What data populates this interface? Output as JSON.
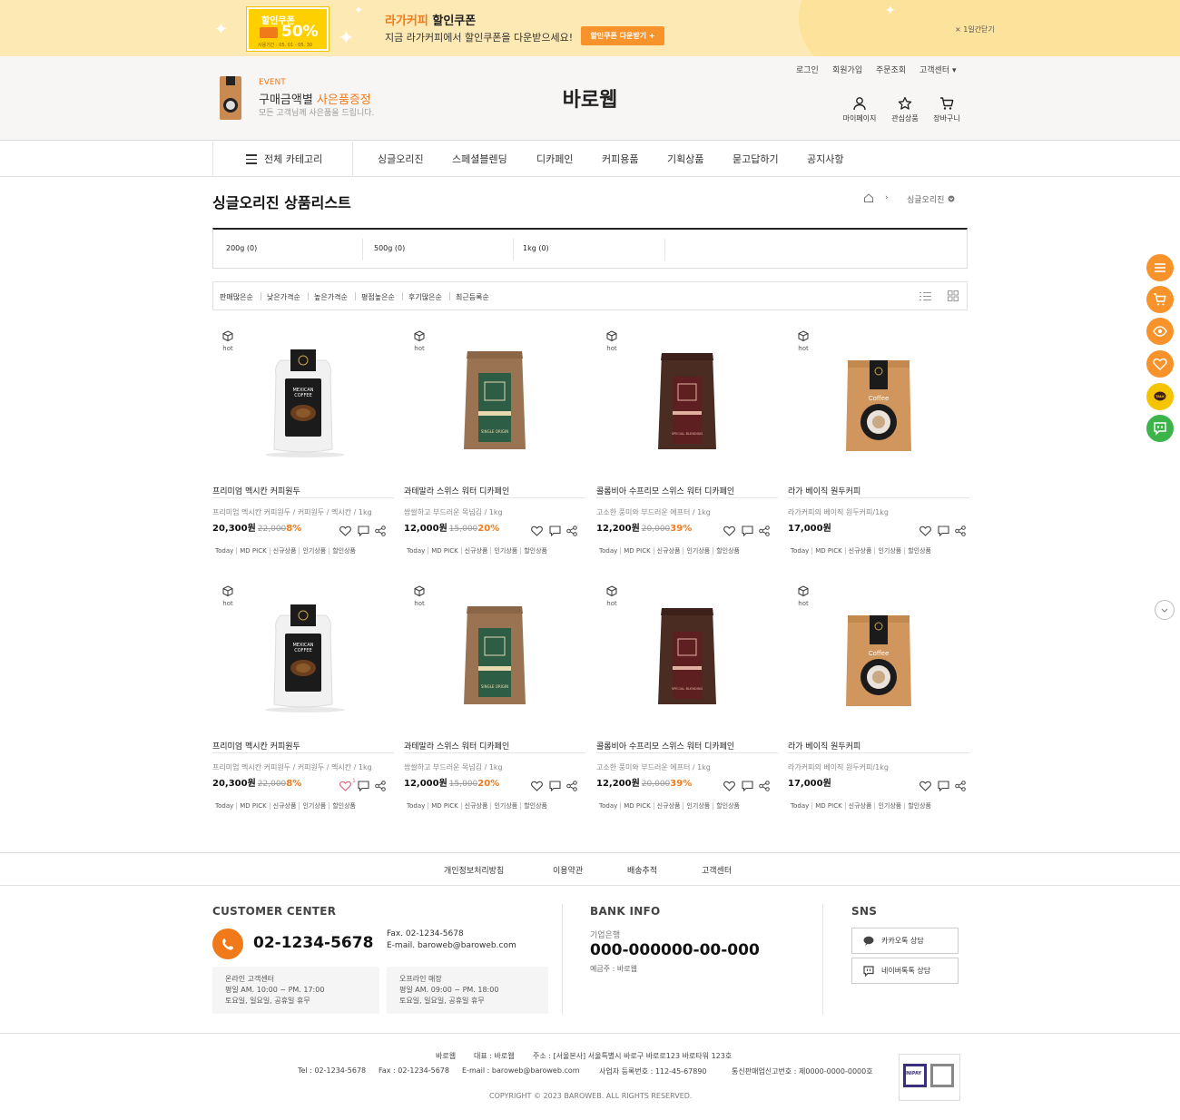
{
  "banner": {
    "coupon_line1": "할인쿠폰",
    "coupon_percent": "50%",
    "coupon_period": "사용기간 : 05. 01 - 05. 30",
    "title_brand": "라가커피",
    "title_rest": " 할인쿠폰",
    "subtitle": "지금 라가커피에서 할인쿠폰을 다운받으세요!",
    "download_button": "할인쿠폰 다운받기 +",
    "close_label": "× 1일간닫기"
  },
  "header": {
    "top_menu": [
      "로그인",
      "회원가입",
      "주문조회",
      "고객센터 ▾"
    ],
    "event_label": "EVENT",
    "event_title_a": "구매금액별 ",
    "event_title_b": "사은품증정",
    "event_subtitle": "모든 고객님께 사은품을 드립니다.",
    "logo": "바로웹",
    "icons": [
      {
        "icon": "person-icon",
        "label": "마이페이지"
      },
      {
        "icon": "star-icon",
        "label": "관심상품"
      },
      {
        "icon": "cart-icon",
        "label": "장바구니"
      }
    ]
  },
  "nav": {
    "all_category": "전체 카테고리",
    "items": [
      "싱글오리진",
      "스페셜블렌딩",
      "디카페인",
      "커피용품",
      "기획상품",
      "묻고답하기",
      "공지사항"
    ]
  },
  "page": {
    "title": "싱글오리진 상품리스트",
    "breadcrumb_current": "싱글오리진"
  },
  "weight_tabs": [
    "200g (0)",
    "500g (0)",
    "1kg (0)"
  ],
  "sort_options": [
    "판매많은순",
    "낮은가격순",
    "높은가격순",
    "평점높은순",
    "후기많은순",
    "최근등록순"
  ],
  "hot_label": "hot",
  "tags": [
    "Today",
    "MD PICK",
    "신규상품",
    "인기상품",
    "할인상품"
  ],
  "products": [
    {
      "name": "프리미엄 멕시칸 커피원두",
      "desc": "프리미엄 멕시칸 커피원두 / 커피원두 / 멕시칸 / 1kg",
      "price": "20,300원",
      "old_price": "22,000",
      "discount": "8%",
      "pack": "white",
      "pack_text": "MEXICAN COFFEE",
      "like_count": ""
    },
    {
      "name": "과테말라 스위스 워터 디카페인",
      "desc": "쌉쌀하고 부드러운 목넘김 / 1kg",
      "price": "12,000원",
      "old_price": "15,000",
      "discount": "20%",
      "pack": "kraft-green",
      "pack_text": "SINGLE ORIGIN",
      "like_count": ""
    },
    {
      "name": "콜롬비아 수프리모 스위스 워터 디카페인",
      "desc": "고소한 풍미와 부드러운 에프터 / 1kg",
      "price": "12,200원",
      "old_price": "20,000",
      "discount": "39%",
      "pack": "dark-red",
      "pack_text": "SPECIAL BLENDING",
      "like_count": ""
    },
    {
      "name": "라가 베이직 원두커피",
      "desc": "라가커피의 베이직 원두커피/1kg",
      "price": "17,000원",
      "old_price": "",
      "discount": "",
      "pack": "orange",
      "pack_text": "Coffee",
      "like_count": ""
    },
    {
      "name": "프리미엄 멕시칸 커피원두",
      "desc": "프리미엄 멕시칸 커피원두 / 커피원두 / 멕시칸 / 1kg",
      "price": "20,300원",
      "old_price": "22,000",
      "discount": "8%",
      "pack": "white",
      "pack_text": "MEXICAN COFFEE",
      "like_count": "1"
    },
    {
      "name": "과테말라 스위스 워터 디카페인",
      "desc": "쌉쌀하고 부드러운 목넘김 / 1kg",
      "price": "12,000원",
      "old_price": "15,000",
      "discount": "20%",
      "pack": "kraft-green",
      "pack_text": "SINGLE ORIGIN",
      "like_count": ""
    },
    {
      "name": "콜롬비아 수프리모 스위스 워터 디카페인",
      "desc": "고소한 풍미와 부드러운 에프터 / 1kg",
      "price": "12,200원",
      "old_price": "20,000",
      "discount": "39%",
      "pack": "dark-red",
      "pack_text": "SPECIAL BLENDING",
      "like_count": ""
    },
    {
      "name": "라가 베이직 원두커피",
      "desc": "라가커피의 베이직 원두커피/1kg",
      "price": "17,000원",
      "old_price": "",
      "discount": "",
      "pack": "orange",
      "pack_text": "Coffee",
      "like_count": ""
    }
  ],
  "floating": [
    {
      "icon": "menu-icon",
      "color": "#f7932a"
    },
    {
      "icon": "cart-icon",
      "color": "#f7932a"
    },
    {
      "icon": "eye-icon",
      "color": "#f7932a"
    },
    {
      "icon": "heart-icon",
      "color": "#f7932a"
    },
    {
      "icon": "kakao-talk-icon",
      "color": "#f5c400"
    },
    {
      "icon": "chat-icon",
      "color": "#3cb44b"
    }
  ],
  "footer": {
    "links": [
      "개인정보처리방침",
      "이용약관",
      "배송추적",
      "고객센터"
    ],
    "cs_title": "CUSTOMER CENTER",
    "cs_phone": "02-1234-5678",
    "cs_fax": "Fax. 02-1234-5678",
    "cs_email": "E-mail. baroweb@baroweb.com",
    "online_hours": [
      "온라인 고객센터",
      "평일 AM. 10:00 ~ PM. 17:00",
      "토요일, 일요일, 공휴일 휴무"
    ],
    "offline_hours": [
      "오프라인 매장",
      "평일 AM. 09:00 ~ PM. 18:00",
      "토요일, 일요일, 공휴일 휴무"
    ],
    "bank_title": "BANK INFO",
    "bank_name": "기업은행",
    "bank_account": "000-000000-00-000",
    "bank_owner": "예금주 : 바로웹",
    "sns_title": "SNS",
    "sns_kakao": "카카오톡 상담",
    "sns_naver": "네이버톡톡 상담",
    "company": "바로웹",
    "ceo": "대표 : 바로웹",
    "address": "주소 : [서울본사] 서울특별시 바로구 바로로123 바로타워 123호",
    "tel": "Tel : 02-1234-5678",
    "fax": "Fax : 02-1234-5678",
    "email": "E-mail : baroweb@baroweb.com",
    "biz_no": "사업자 등록번호 : 112-45-67890",
    "ecom_no": "통신판매업신고번호 : 제0000-0000-0000호",
    "copyright": "COPYRIGHT © 2023 BAROWEB. ALL RIGHTS RESERVED.",
    "badge_text": "INIPAY"
  },
  "colors": {
    "accent": "#f07a1a",
    "banner_bg": "#fde9b4",
    "header_bg": "#f8f6f5"
  }
}
